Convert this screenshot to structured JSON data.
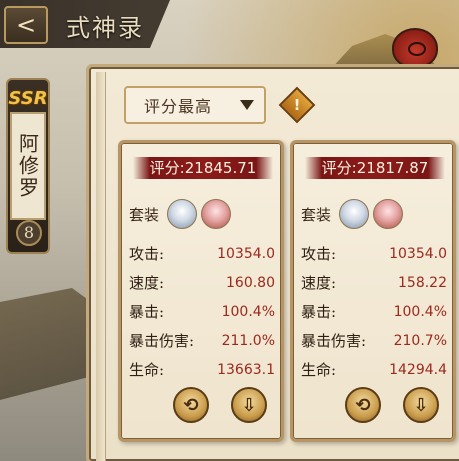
{
  "header": {
    "title": "式神录",
    "back_glyph": "<"
  },
  "character": {
    "rarity": "SSR",
    "name": "阿修罗",
    "number": "8"
  },
  "sort": {
    "selected": "评分最高"
  },
  "info_glyph": "!",
  "cards": [
    {
      "score": "评分:21845.71",
      "set_label": "套装",
      "stats": [
        {
          "label": "攻击:",
          "value": "10354.0"
        },
        {
          "label": "速度:",
          "value": "160.80"
        },
        {
          "label": "暴击:",
          "value": "100.4%"
        },
        {
          "label": "暴击伤害:",
          "value": "211.0%"
        },
        {
          "label": "生命:",
          "value": "13663.1"
        }
      ]
    },
    {
      "score": "评分:21817.87",
      "set_label": "套装",
      "stats": [
        {
          "label": "攻击:",
          "value": "10354.0"
        },
        {
          "label": "速度:",
          "value": "158.22"
        },
        {
          "label": "暴击:",
          "value": "100.4%"
        },
        {
          "label": "暴击伤害:",
          "value": "210.7%"
        },
        {
          "label": "生命:",
          "value": "14294.4"
        }
      ]
    }
  ],
  "icons": {
    "replace": "swap-icon",
    "equip": "download-icon"
  }
}
